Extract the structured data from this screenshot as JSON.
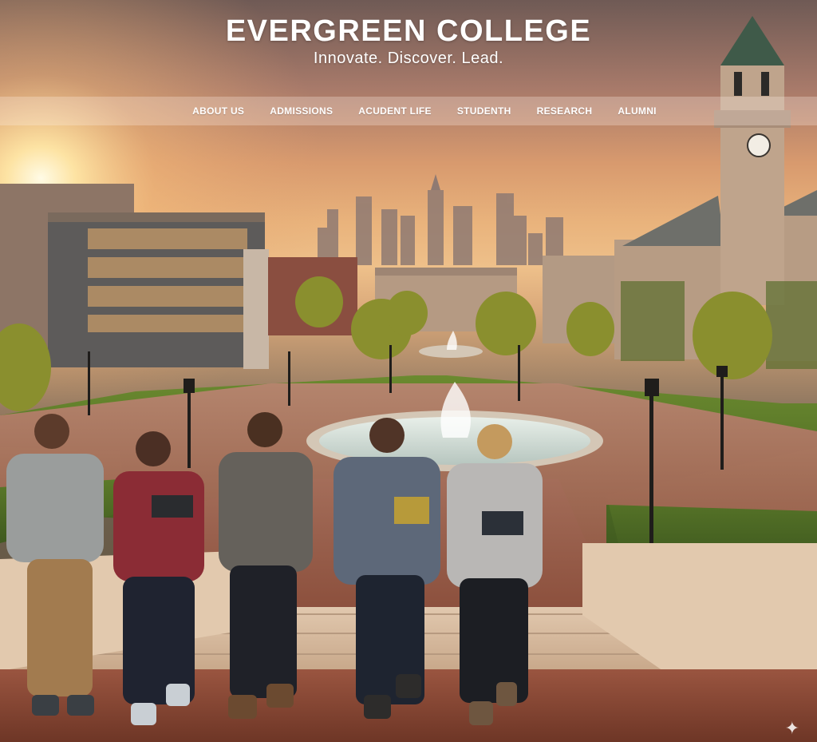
{
  "header": {
    "title": "EVERGREEN COLLEGE",
    "tagline": "Innovate. Discover. Lead."
  },
  "nav": {
    "items": [
      {
        "label": "ABOUT US"
      },
      {
        "label": "ADMISSIONS"
      },
      {
        "label": "ACUDENT LIFE"
      },
      {
        "label": "STUDENTH"
      },
      {
        "label": "RESEARCH"
      },
      {
        "label": "ALUMNI"
      }
    ]
  },
  "hero": {
    "scene": "campus-plaza-at-sunset",
    "colors": {
      "sky_top": "#6f5a55",
      "sun_glow": "#fff2c4",
      "brick": "#8c4a3a",
      "lawn": "#5f7a2c"
    }
  },
  "icons": {
    "corner_sparkle": "sparkle-icon"
  }
}
